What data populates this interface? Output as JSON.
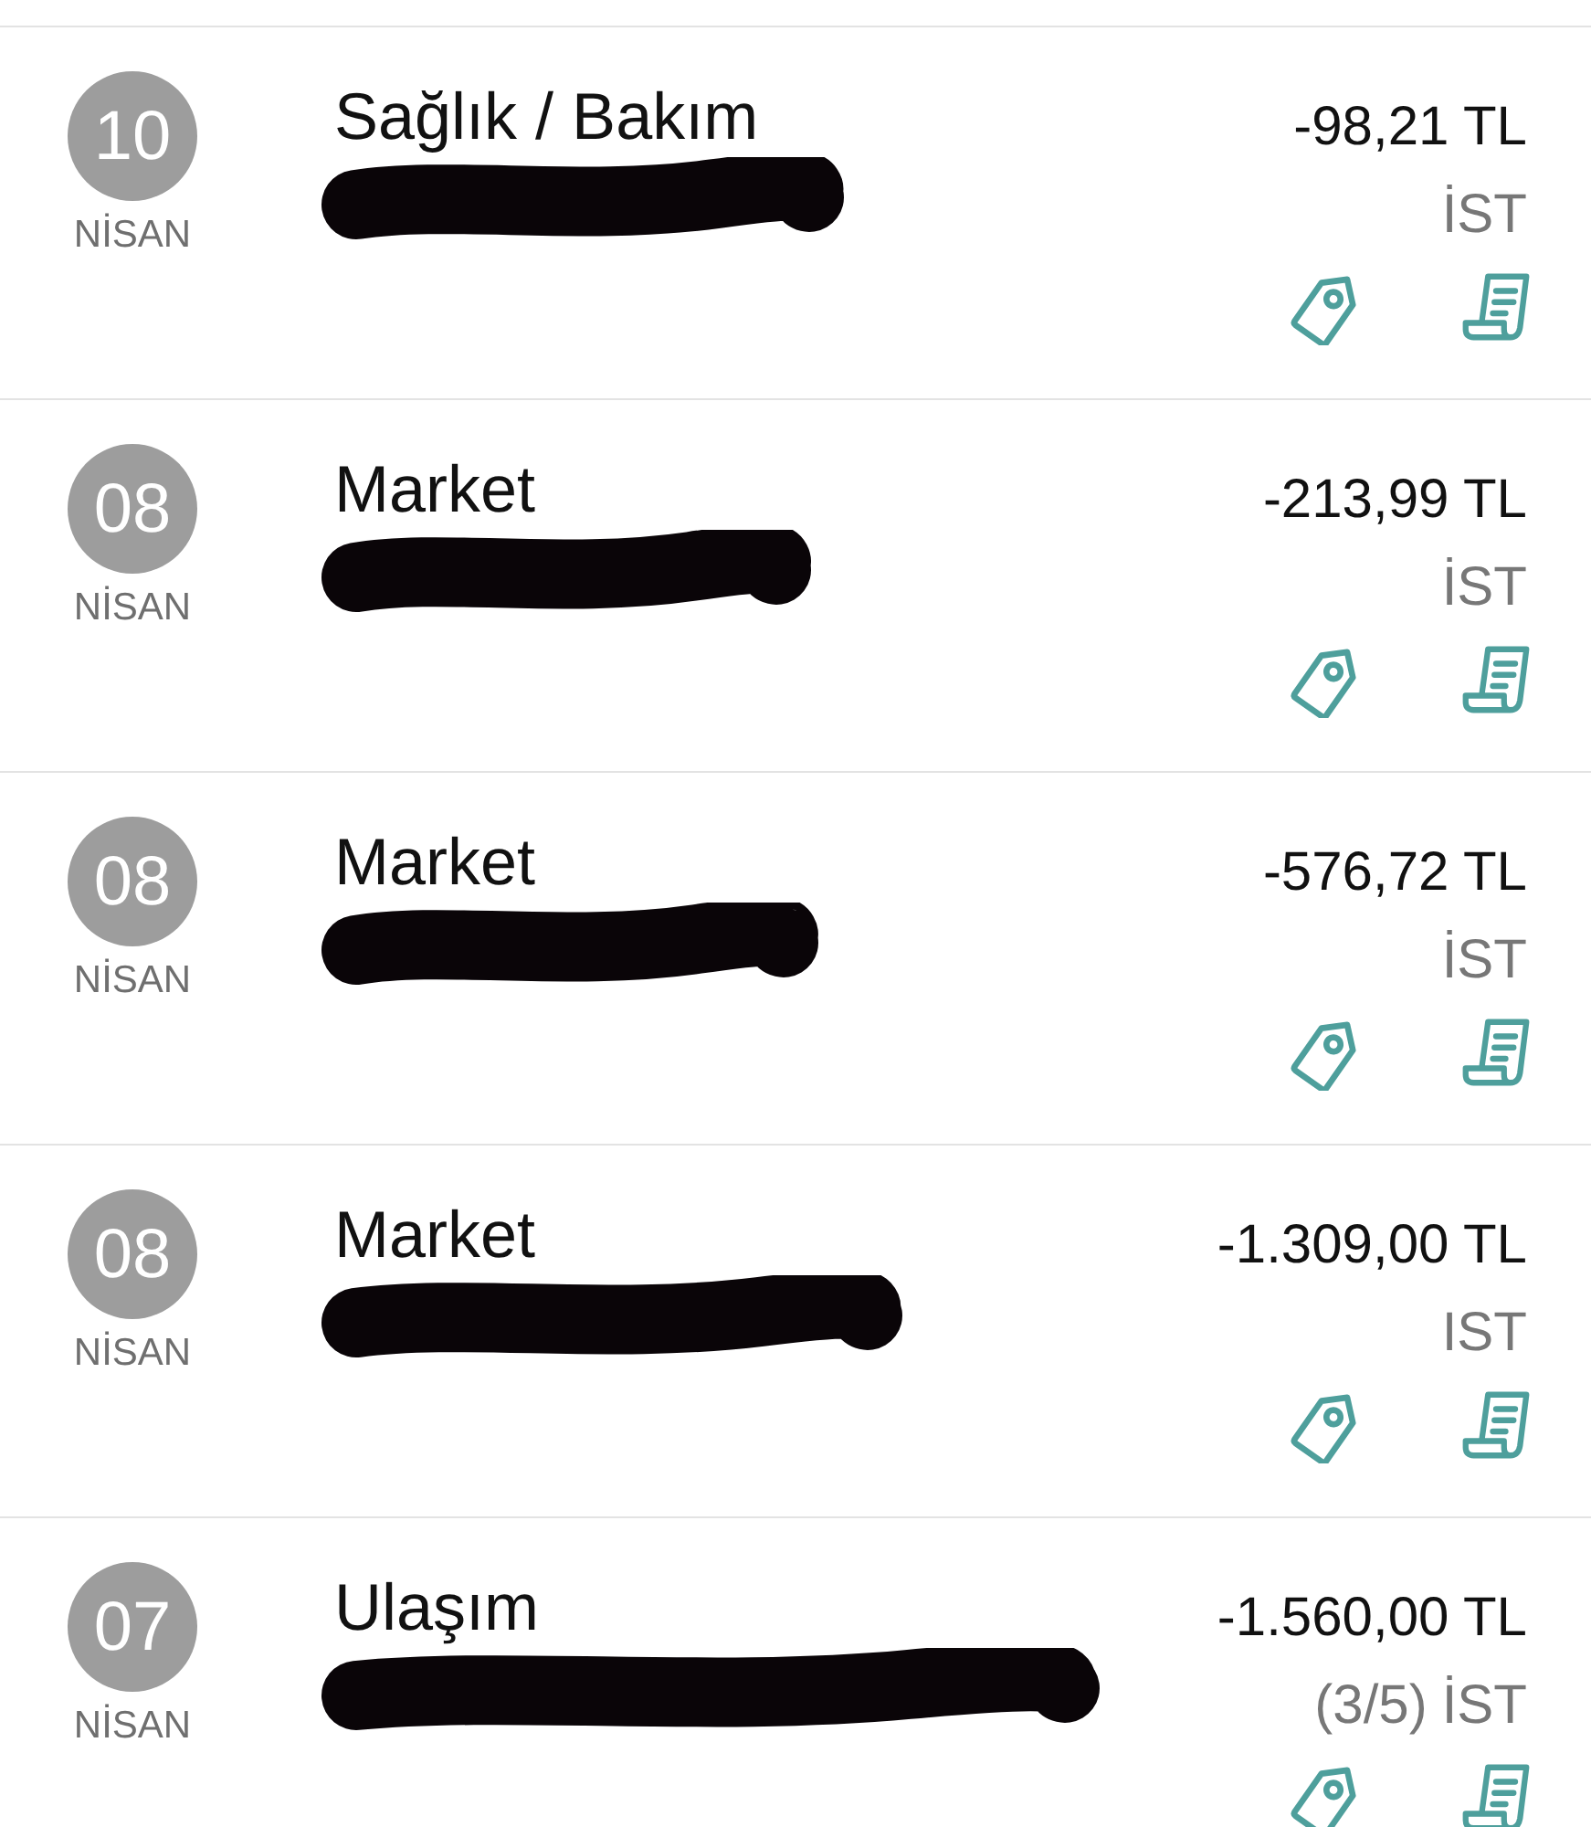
{
  "transactions": [
    {
      "day": "10",
      "month": "NİSAN",
      "category": "Sağlık / Bakım",
      "amount": "-98,21 TL",
      "city": "İST"
    },
    {
      "day": "08",
      "month": "NİSAN",
      "category": "Market",
      "amount": "-213,99 TL",
      "city": "İST"
    },
    {
      "day": "08",
      "month": "NİSAN",
      "category": "Market",
      "amount": "-576,72 TL",
      "city": "İST"
    },
    {
      "day": "08",
      "month": "NİSAN",
      "category": "Market",
      "amount": "-1.309,00 TL",
      "city": "IST"
    },
    {
      "day": "07",
      "month": "NİSAN",
      "category": "Ulaşım",
      "amount": "-1.560,00 TL",
      "installment": "(3/5)",
      "city": "İST"
    }
  ]
}
